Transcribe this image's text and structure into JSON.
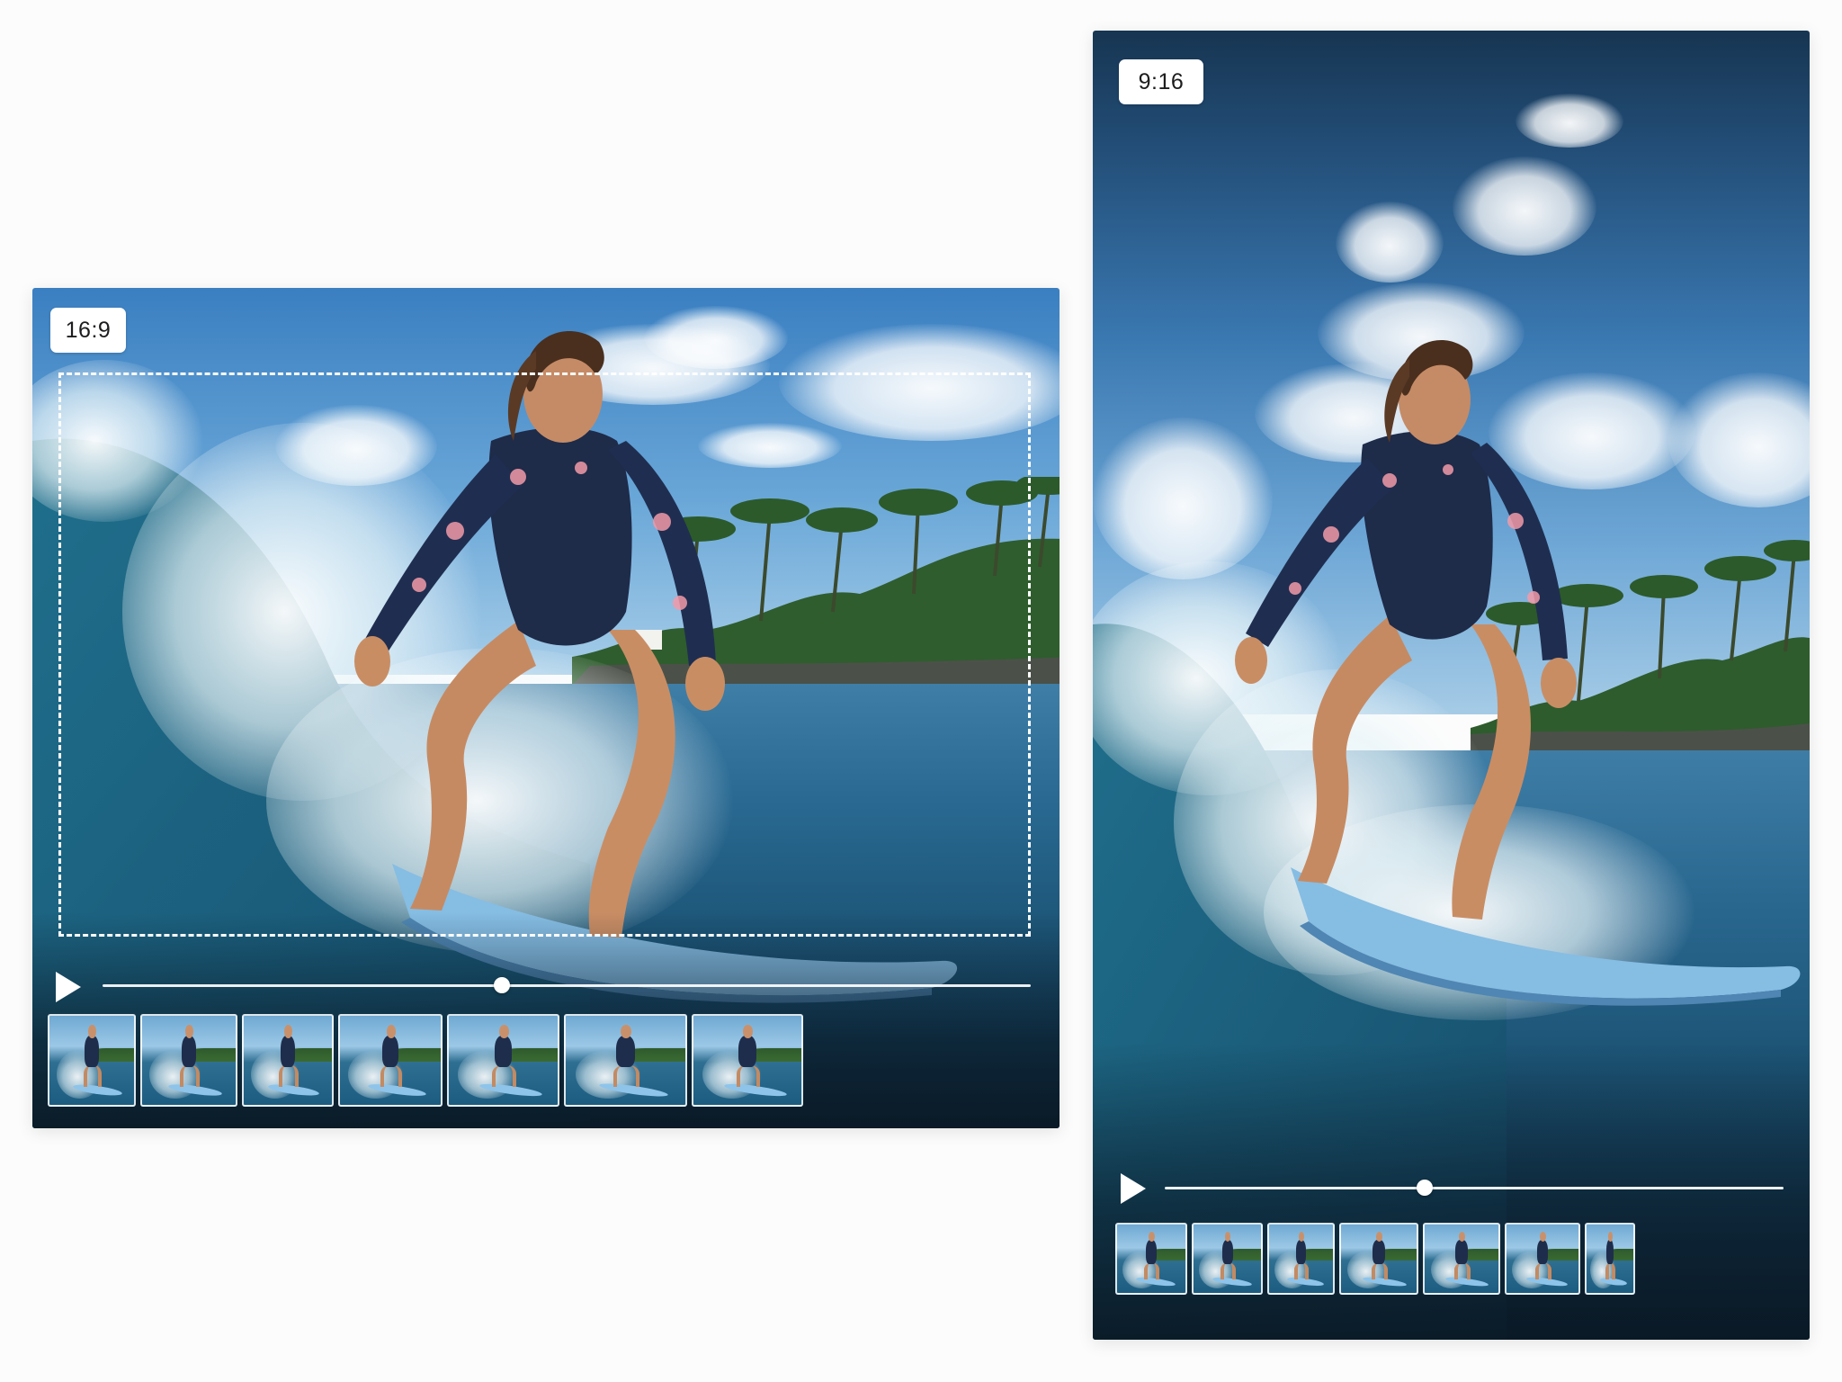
{
  "players": [
    {
      "id": "landscape",
      "aspect_label": "16:9",
      "show_crop_frame": true,
      "playback": {
        "state": "paused",
        "progress": 0.43
      },
      "filmstrip_frame_count": 7
    },
    {
      "id": "portrait",
      "aspect_label": "9:16",
      "show_crop_frame": false,
      "playback": {
        "state": "paused",
        "progress": 0.42
      },
      "filmstrip_frame_count": 7
    }
  ],
  "icons": {
    "play": "play-icon"
  },
  "colors": {
    "page_background": "#fcfcfc",
    "badge_background": "#ffffff",
    "badge_text": "#1d1d1f",
    "sky_top": "#3f86c6",
    "sea_deep": "#0f3552",
    "control_white": "#ffffff"
  }
}
